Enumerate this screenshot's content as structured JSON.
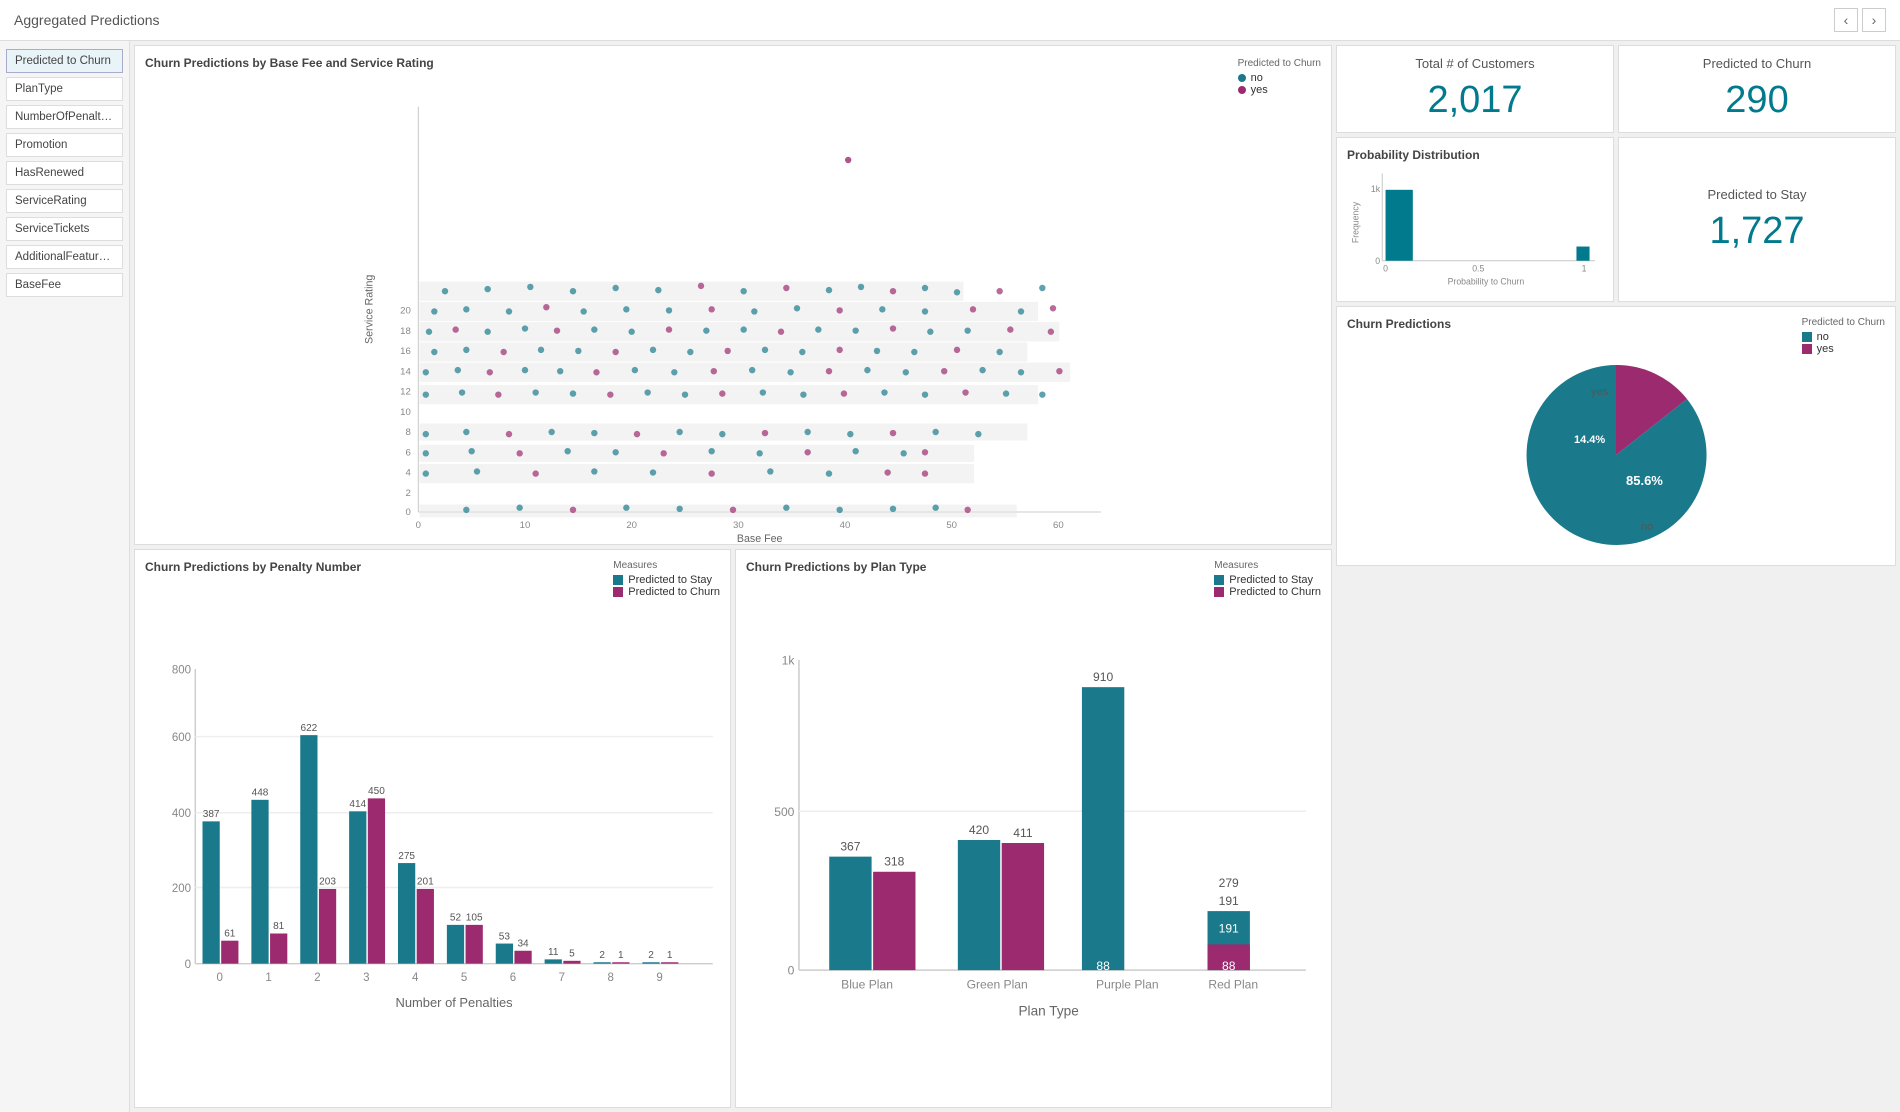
{
  "header": {
    "title": "Aggregated Predictions"
  },
  "sidebar": {
    "items": [
      {
        "label": "Predicted to Churn",
        "active": true
      },
      {
        "label": "PlanType",
        "active": false
      },
      {
        "label": "NumberOfPenalties",
        "active": false
      },
      {
        "label": "Promotion",
        "active": false
      },
      {
        "label": "HasRenewed",
        "active": false
      },
      {
        "label": "ServiceRating",
        "active": false
      },
      {
        "label": "ServiceTickets",
        "active": false
      },
      {
        "label": "AdditionalFeatureSp...",
        "active": false
      },
      {
        "label": "BaseFee",
        "active": false
      }
    ]
  },
  "scatter": {
    "title": "Churn Predictions by Base Fee and Service Rating",
    "xLabel": "Base Fee",
    "yLabel": "Service Rating",
    "legend": {
      "title": "Predicted to Churn",
      "items": [
        {
          "label": "no",
          "color": "#1a7a8c"
        },
        {
          "label": "yes",
          "color": "#9b2b6e"
        }
      ]
    }
  },
  "kpis": {
    "total_customers_label": "Total # of Customers",
    "total_customers_value": "2,017",
    "predicted_churn_label": "Predicted to Churn",
    "predicted_churn_value": "290",
    "predicted_stay_label": "Predicted to Stay",
    "predicted_stay_value": "1,727"
  },
  "prob_dist": {
    "title": "Probability Distribution",
    "xLabel": "Probability to Churn",
    "yLabel": "Frequency",
    "yTicks": [
      "0",
      "1k"
    ],
    "xTicks": [
      "0",
      "0.5",
      "1"
    ]
  },
  "churn_predictions": {
    "title": "Churn Predictions",
    "legend": {
      "title": "Predicted to Churn",
      "items": [
        {
          "label": "no",
          "color": "#1a7a8c"
        },
        {
          "label": "yes",
          "color": "#9b2b6e"
        }
      ]
    },
    "pie": {
      "yes_pct": 14.4,
      "no_pct": 85.6,
      "yes_label": "yes",
      "no_label": "no",
      "yes_pct_label": "14.4%",
      "no_pct_label": "85.6%"
    }
  },
  "bar_penalty": {
    "title": "Churn Predictions by Penalty Number",
    "xLabel": "Number of Penalties",
    "yLabel": "",
    "yTicks": [
      "0",
      "200",
      "400",
      "600",
      "800"
    ],
    "xTicks": [
      "0",
      "1",
      "2",
      "3",
      "4",
      "5",
      "6",
      "7",
      "8",
      "9"
    ],
    "legend": {
      "title": "Measures",
      "items": [
        {
          "label": "Predicted to Stay",
          "color": "#1a7a8c"
        },
        {
          "label": "Predicted to Churn",
          "color": "#9b2b6e"
        }
      ]
    },
    "bars": [
      {
        "x": "0",
        "stay": 387,
        "churn": 61
      },
      {
        "x": "1",
        "stay": 448,
        "churn": 81
      },
      {
        "x": "2",
        "stay": 622,
        "churn": 203
      },
      {
        "x": "3",
        "stay": 414,
        "churn": 450
      },
      {
        "x": "4",
        "stay": 275,
        "churn": 201
      },
      {
        "x": "5",
        "stay": 52,
        "churn": 105
      },
      {
        "x": "6",
        "stay": 53,
        "churn": 34
      },
      {
        "x": "7",
        "stay": 11,
        "churn": 5
      },
      {
        "x": "8",
        "stay": 2,
        "churn": 1
      },
      {
        "x": "9",
        "stay": 2,
        "churn": 1
      }
    ]
  },
  "bar_plan": {
    "title": "Churn Predictions by Plan Type",
    "xLabel": "Plan Type",
    "yLabel": "",
    "yTicks": [
      "0",
      "500",
      "1k"
    ],
    "xTicks": [
      "Blue Plan",
      "Green Plan",
      "Purple Plan",
      "Red Plan"
    ],
    "legend": {
      "title": "Measures",
      "items": [
        {
          "label": "Predicted to Stay",
          "color": "#1a7a8c"
        },
        {
          "label": "Predicted to Churn",
          "color": "#9b2b6e"
        }
      ]
    },
    "bars": [
      {
        "x": "Blue Plan",
        "stay": 367,
        "churn": 318
      },
      {
        "x": "Green Plan",
        "stay": 420,
        "churn": 411
      },
      {
        "x": "Purple Plan",
        "stay": 910,
        "churn": 0
      },
      {
        "x": "Red Plan",
        "stay": 191,
        "churn": 88
      }
    ]
  }
}
